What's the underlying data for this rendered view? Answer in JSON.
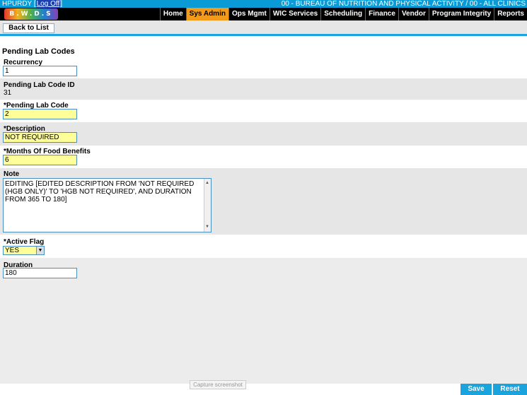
{
  "topbar": {
    "user": "HPURDY",
    "logoff": "Log Off",
    "bureau": "00 - BUREAU OF NUTRITION AND PHYSICAL ACTIVITY / 00 - ALL CLINICS"
  },
  "logo_text": "B.W.D.S",
  "menu": [
    "Home",
    "Sys Admin",
    "Ops Mgmt",
    "WIC Services",
    "Scheduling",
    "Finance",
    "Vendor",
    "Program Integrity",
    "Reports"
  ],
  "active_menu": "Sys Admin",
  "toolbar": {
    "back_label": "Back to List"
  },
  "page": {
    "title": "Pending Lab Codes",
    "recurrency_label": "Recurrency",
    "recurrency_value": "1",
    "id_label": "Pending Lab Code ID",
    "id_value": "31",
    "code_label": "*Pending Lab Code",
    "code_value": "2",
    "desc_label": "*Description",
    "desc_value": "NOT REQUIRED",
    "months_label": "*Months Of Food Benefits",
    "months_value": "6",
    "note_label": "Note",
    "note_value": "EDITING [EDITED DESCRIPTION FROM 'NOT REQUIRED (HGB ONLY)' TO 'HGB NOT REQUIRED', AND DURATION FROM 365 TO 180]",
    "active_label": "*Active Flag",
    "active_value": "YES",
    "duration_label": "Duration",
    "duration_value": "180"
  },
  "capture_text": "Capture screenshot",
  "buttons": {
    "save": "Save",
    "reset": "Reset"
  },
  "colors": {
    "accent": "#1aa3dc",
    "active_tab": "#f29a1c",
    "required_field": "#ffff99"
  }
}
